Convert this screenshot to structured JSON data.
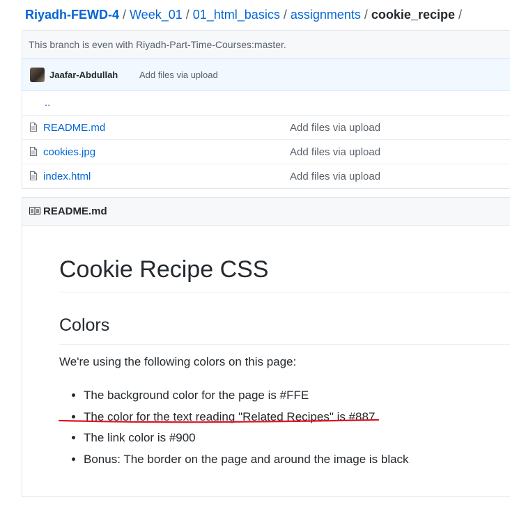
{
  "breadcrumb": {
    "root": "Riyadh-FEWD-4",
    "items": [
      "Week_01",
      "01_html_basics",
      "assignments"
    ],
    "current": "cookie_recipe",
    "separator": "/"
  },
  "branch_info": "This branch is even with Riyadh-Part-Time-Courses:master.",
  "commit": {
    "author": "Jaafar-Abdullah",
    "message": "Add files via upload"
  },
  "files": {
    "parent": "..",
    "rows": [
      {
        "name": "README.md",
        "message": "Add files via upload"
      },
      {
        "name": "cookies.jpg",
        "message": "Add files via upload"
      },
      {
        "name": "index.html",
        "message": "Add files via upload"
      }
    ]
  },
  "readme": {
    "header": "README.md",
    "h1": "Cookie Recipe CSS",
    "h2": "Colors",
    "intro": "We're using the following colors on this page:",
    "bullets": [
      "The background color for the page is #FFE",
      "The color for the text reading \"Related Recipes\" is #887",
      "The link color is #900",
      "Bonus: The border on the page and around the image is black"
    ]
  },
  "colors": {
    "link": "#0366d6",
    "annotation": "#e0141e"
  }
}
